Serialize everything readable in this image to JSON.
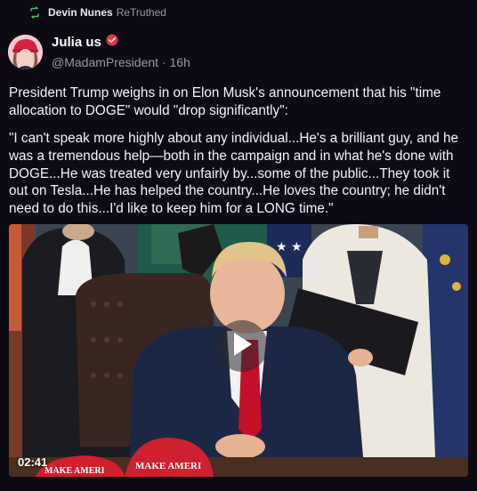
{
  "retruth": {
    "user": "Devin Nunes",
    "action": "ReTruthed",
    "icon": "retruth-icon"
  },
  "post": {
    "author_name": "Julia us",
    "verified_icon": "verified-badge-icon",
    "handle": "@MadamPresident",
    "separator": "·",
    "time": "16h",
    "paragraphs": [
      "President Trump weighs in on Elon Musk's announcement that his \"time allocation to DOGE\" would \"drop significantly\":",
      "\"I can't speak more highly about any individual...He's a brilliant guy, and he was a tremendous help—both in the campaign and in what he's done with DOGE...He was treated very unfairly by...some of the public...They took it out on Tesla...He has helped the country...He loves the country; he didn't need to do this...I'd like to keep him for a LONG time.\""
    ],
    "video": {
      "duration": "02:41",
      "play_icon": "play-icon",
      "hat_text_left": "MAKE AMERI",
      "hat_text_right": "MAKE AMERI"
    }
  },
  "colors": {
    "background": "#0d0a14",
    "retruth_icon": "#3fbf6f",
    "verified": "#e8344e",
    "muted_text": "#9a96a6"
  }
}
